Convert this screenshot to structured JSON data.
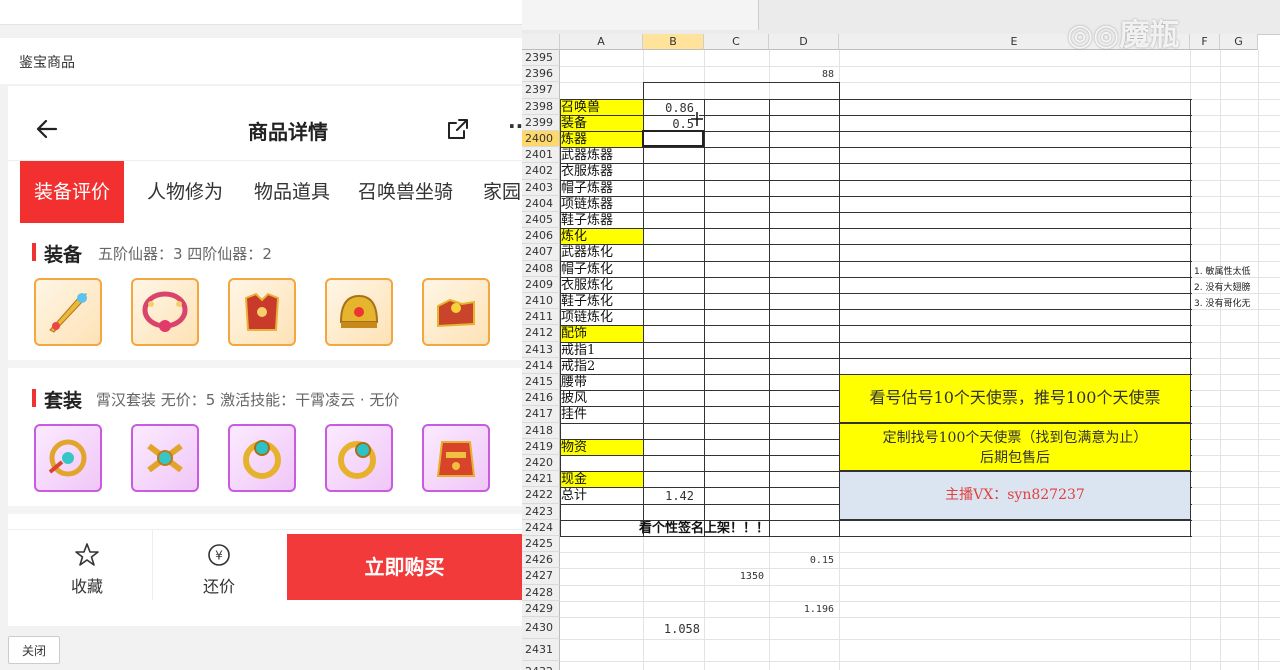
{
  "left": {
    "page_label": "鉴宝商品",
    "nav_title": "商品详情",
    "tabs": [
      "装备评价",
      "人物修为",
      "物品道具",
      "召唤兽坐骑",
      "家园"
    ],
    "equip": {
      "title": "装备",
      "subtitle": "五阶仙器：3   四阶仙器：2"
    },
    "suit": {
      "title": "套装",
      "subtitle": "霄汉套装   无价：5   激活技能：干霄凌云 · 无价"
    },
    "bottom": {
      "favorite": "收藏",
      "bargain": "还价",
      "buy": "立即购买"
    },
    "close": "关闭"
  },
  "sheet": {
    "columns": [
      "A",
      "B",
      "C",
      "D",
      "E",
      "F",
      "G"
    ],
    "rows": [
      "2395",
      "2396",
      "2397",
      "2398",
      "2399",
      "2400",
      "2401",
      "2402",
      "2403",
      "2404",
      "2405",
      "2406",
      "2407",
      "2408",
      "2409",
      "2410",
      "2411",
      "2412",
      "2413",
      "2414",
      "2415",
      "2416",
      "2417",
      "2418",
      "2419",
      "2420",
      "2421",
      "2422",
      "2423",
      "2424",
      "2425",
      "2426",
      "2427",
      "2428",
      "2429",
      "2430",
      "2431",
      "2432"
    ],
    "labels": {
      "r2398": "召唤兽",
      "r2399": "装备",
      "r2400": "炼器",
      "r2401": "武器炼器",
      "r2402": "衣服炼器",
      "r2403": "帽子炼器",
      "r2404": "项链炼器",
      "r2405": "鞋子炼器",
      "r2406": "炼化",
      "r2407": "武器炼化",
      "r2408": "帽子炼化",
      "r2409": "衣服炼化",
      "r2410": "鞋子炼化",
      "r2411": "项链炼化",
      "r2412": "配饰",
      "r2413": "戒指1",
      "r2414": "戒指2",
      "r2415": "腰带",
      "r2416": "披风",
      "r2417": "挂件",
      "r2419": "物资",
      "r2421": "现金",
      "r2422": "总计"
    },
    "values": {
      "d2396": "88",
      "b2398": "0.86",
      "b2399": "0.5",
      "b2422": "1.42",
      "r2424": "看个性签名上架！！！",
      "d2426": "0.15",
      "c2427": "1350",
      "d2429": "1.196",
      "b2430": "1.058"
    },
    "banner1": "看号估号10个天使票，推号100个天使票",
    "banner2_line1": "定制找号100个天使票（找到包满意为止）",
    "banner2_line2": "后期包售后",
    "contact": "主播VX：syn827237",
    "notes": [
      "1. 敏属性太低",
      "2. 没有大翅膀",
      "3. 没有哥化无"
    ]
  },
  "colors": {
    "accent_red": "#f23030",
    "highlight_yellow": "#ffff00",
    "contact_bg": "#dbe5f1"
  }
}
